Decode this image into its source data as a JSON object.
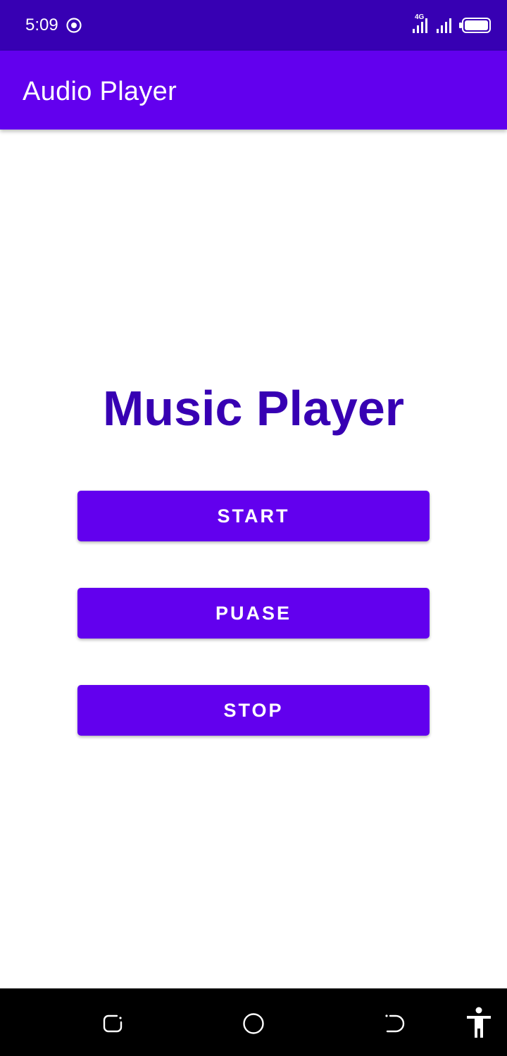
{
  "status_bar": {
    "time": "5:09",
    "network_label": "4G",
    "icons": [
      "record-icon",
      "signal-4g-icon",
      "signal-icon",
      "battery-icon"
    ],
    "background_color": "#3700b3"
  },
  "app_bar": {
    "title": "Audio Player",
    "background_color": "#6200ee"
  },
  "main": {
    "title": "Music Player",
    "title_color": "#3700b3",
    "buttons": [
      {
        "label": "START"
      },
      {
        "label": "PUASE"
      },
      {
        "label": "STOP"
      }
    ],
    "button_color": "#6200ee"
  },
  "nav_bar": {
    "icons": [
      "recents-icon",
      "home-icon",
      "back-icon",
      "accessibility-icon"
    ]
  }
}
